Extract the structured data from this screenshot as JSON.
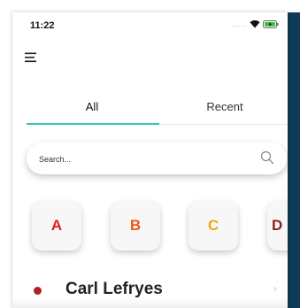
{
  "status_bar": {
    "time": "11:22",
    "signal_dots": "....."
  },
  "colors": {
    "accent": "#2ec4b6",
    "contact_dot": "#b3202a",
    "letter_colors": [
      "#e0201f",
      "#ee5a14",
      "#f2a90a",
      "#8f1f1f"
    ]
  },
  "tabs": [
    {
      "label": "All",
      "active": true
    },
    {
      "label": "Recent",
      "active": false
    }
  ],
  "search": {
    "placeholder": "Search...",
    "value": ""
  },
  "letters": [
    "A",
    "B",
    "C",
    "D"
  ],
  "contacts": [
    {
      "name": "Carl Lefryes"
    }
  ]
}
